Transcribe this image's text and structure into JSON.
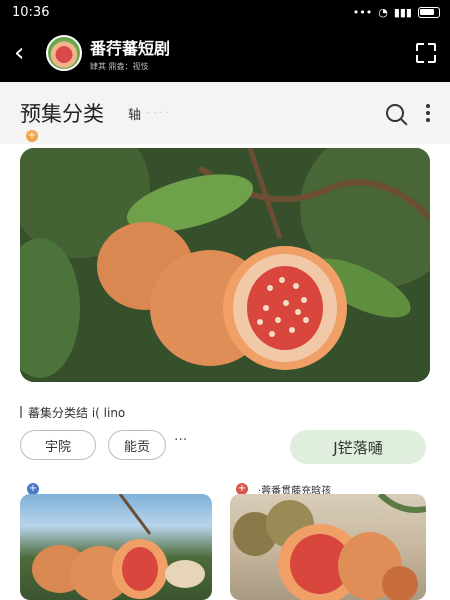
{
  "status": {
    "time": "10:36"
  },
  "header": {
    "title": "番荇蕃短剧",
    "subtitle": "肄其 鼎盎：视忮"
  },
  "section": {
    "title": "预集分类",
    "tag": "轴",
    "tag_dim": "· · · ·"
  },
  "filters": {
    "label": "蕃集分类结 i( lino",
    "chips": [
      "宇院",
      "能贡"
    ],
    "more": "···",
    "action_label": "J铓落嗵"
  },
  "thumbs": {
    "caption": "·蓉番贯藤充晗孩"
  },
  "colors": {
    "accent": "#f0a447",
    "action_bg": "#dfeedd",
    "header_bg": "#000000"
  },
  "icons": [
    "back-arrow-icon",
    "share-icon",
    "search-icon",
    "more-icon",
    "plus-icon"
  ]
}
